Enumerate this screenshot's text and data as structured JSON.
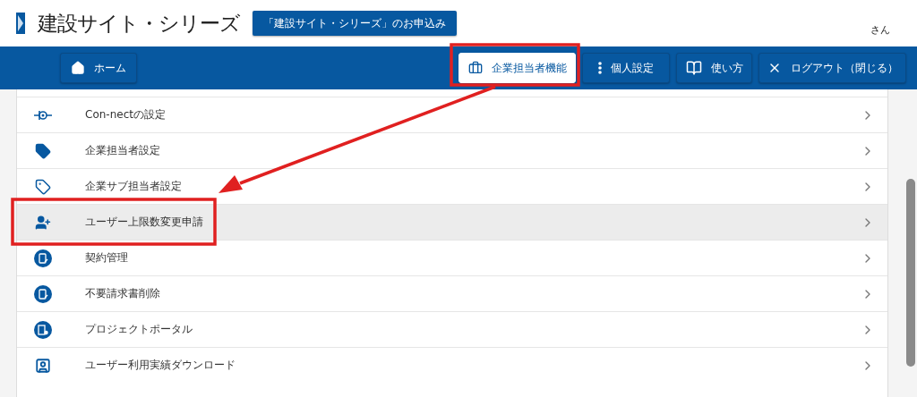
{
  "header": {
    "title": "建設サイト・シリーズ",
    "apply_button": "「建設サイト・シリーズ」のお申込み",
    "user_suffix": "さん"
  },
  "nav": [
    {
      "label": "ホーム",
      "selected": false
    },
    {
      "label": "企業担当者機能",
      "selected": true
    },
    {
      "label": "個人設定",
      "selected": false
    },
    {
      "label": "使い方",
      "selected": false
    },
    {
      "label": "ログアウト（閉じる）",
      "selected": false
    }
  ],
  "menu": [
    {
      "label": "Con-nectの設定",
      "selected": false
    },
    {
      "label": "企業担当者設定",
      "selected": false
    },
    {
      "label": "企業サブ担当者設定",
      "selected": false
    },
    {
      "label": "ユーザー上限数変更申請",
      "selected": true
    },
    {
      "label": "契約管理",
      "selected": false
    },
    {
      "label": "不要請求書削除",
      "selected": false
    },
    {
      "label": "プロジェクトポータル",
      "selected": false
    },
    {
      "label": "ユーザー利用実績ダウンロード",
      "selected": false
    }
  ]
}
